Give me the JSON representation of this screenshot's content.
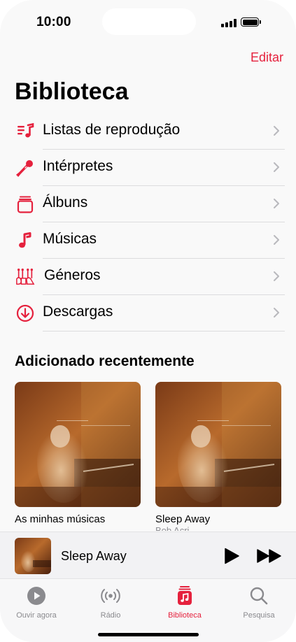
{
  "status_bar": {
    "time": "10:00"
  },
  "header": {
    "edit_label": "Editar",
    "title": "Biblioteca"
  },
  "library_items": [
    {
      "label": "Listas de reprodução",
      "icon": "playlist-icon"
    },
    {
      "label": "Intérpretes",
      "icon": "microphone-icon"
    },
    {
      "label": "Álbuns",
      "icon": "album-icon"
    },
    {
      "label": "Músicas",
      "icon": "music-note-icon"
    },
    {
      "label": "Géneros",
      "icon": "genres-icon"
    },
    {
      "label": "Descargas",
      "icon": "download-icon"
    }
  ],
  "recent": {
    "title": "Adicionado recentemente",
    "albums": [
      {
        "caption": "As minhas músicas",
        "sub": ""
      },
      {
        "caption": "Sleep Away",
        "sub": "Bob Acri"
      }
    ]
  },
  "mini_player": {
    "title": "Sleep Away"
  },
  "tabs": [
    {
      "label": "Ouvir agora",
      "icon": "play-circle-icon",
      "active": false
    },
    {
      "label": "Rádio",
      "icon": "radio-icon",
      "active": false
    },
    {
      "label": "Biblioteca",
      "icon": "library-icon",
      "active": true
    },
    {
      "label": "Pesquisa",
      "icon": "search-icon",
      "active": false
    }
  ],
  "colors": {
    "accent": "#e5213d",
    "tab_inactive": "#8a8a8e",
    "separator": "#dcdcde"
  }
}
